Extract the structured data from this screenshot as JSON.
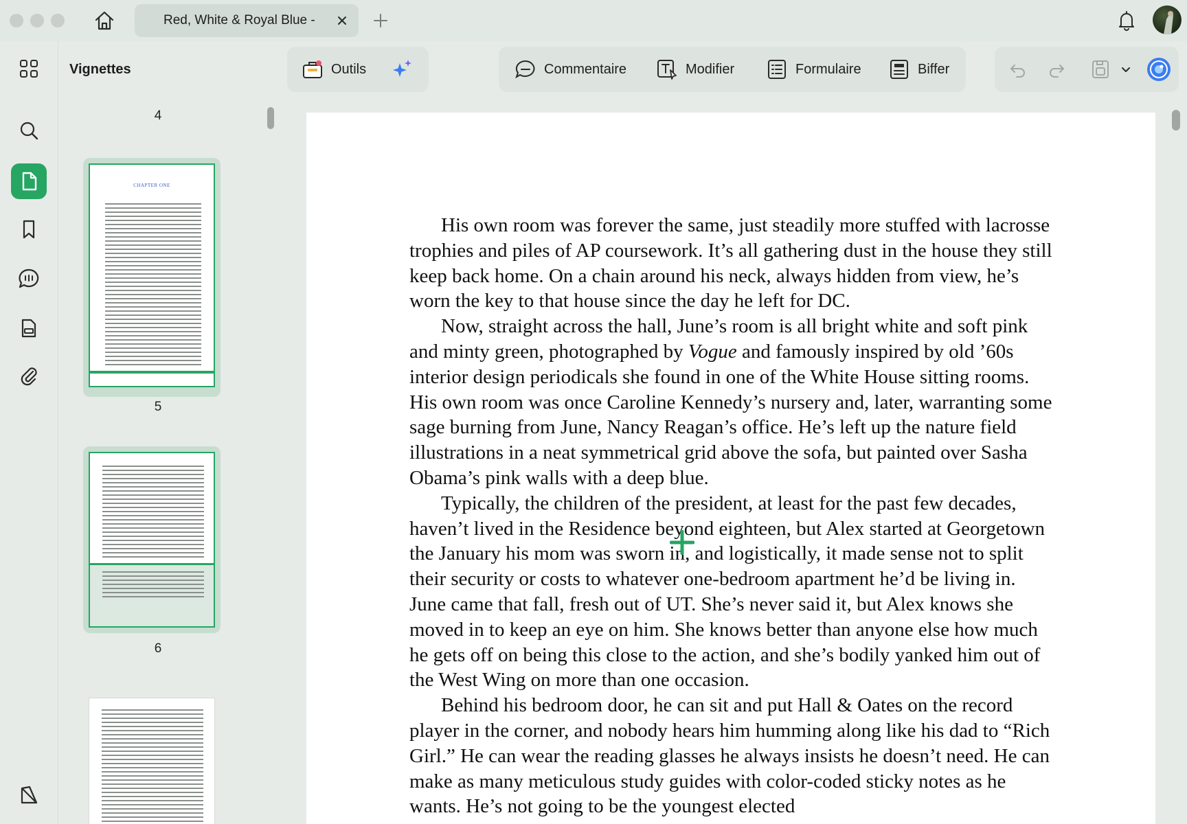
{
  "window": {
    "tab_title": "Red, White & Royal Blue - ",
    "icons": [
      "home-icon",
      "close-icon",
      "plus-icon",
      "bell-icon"
    ]
  },
  "sidebar": {
    "title": "Vignettes",
    "rail_icons": [
      "grid-icon",
      "search-icon",
      "pages-icon",
      "bookmark-icon",
      "comment-icon",
      "form-icon",
      "attachment-icon",
      "layers-icon"
    ],
    "pages": [
      {
        "label": "4",
        "chapter": "CHAPTER ONE"
      },
      {
        "label": "5"
      },
      {
        "label": "6"
      }
    ]
  },
  "toolbar": {
    "tools_label": "Outils",
    "comment_label": "Commentaire",
    "edit_label": "Modifier",
    "form_label": "Formulaire",
    "redact_label": "Biffer"
  },
  "document": {
    "paragraphs": [
      {
        "before": "His own room was forever the same, just steadily more stuffed with lacrosse trophies and piles of AP coursework. It’s all gathering dust in the house they still keep back home. On a chain around his neck, always hidden from view, he’s worn the key to that house since the day he left for DC."
      },
      {
        "before": "Now, straight across the hall, June’s room is all bright white and soft pink and minty green, photographed by ",
        "italic": "Vogue",
        "after": " and famously inspired by old ’60s interior design periodicals she found in one of the White House sitting rooms. His own room was once Caroline Kennedy’s nursery and, later, warranting some sage burning from June, Nancy Reagan’s office. He’s left up the nature field illustrations in a neat symmetrical grid above the sofa, but painted over Sasha Obama’s pink walls with a deep blue."
      },
      {
        "before": "Typically, the children of the president, at least for the past few decades, haven’t lived in the Residence beyond eighteen, but Alex started at Georgetown the January his mom was sworn in, and logistically, it made sense not to split their security or costs to whatever one-bedroom apartment he’d be living in. June came that fall, fresh out of UT. She’s never said it, but Alex knows she moved in to keep an eye on him. She knows better than anyone else how much he gets off on being this close to the action, and she’s bodily yanked him out of the West Wing on more than one occasion."
      },
      {
        "before": "Behind his bedroom door, he can sit and put Hall & Oates on the record player in the corner, and nobody hears him humming along like his dad to “Rich Girl.” He can wear the reading glasses he always insists he doesn’t need. He can make as many meticulous study guides with color-coded sticky notes as he wants. He’s not going to be the youngest elected"
      }
    ]
  },
  "colors": {
    "accent": "#27a563",
    "chapter_heading": "#3a58c8",
    "background": "#e6ebe7",
    "toolbar": "#dde4df"
  }
}
